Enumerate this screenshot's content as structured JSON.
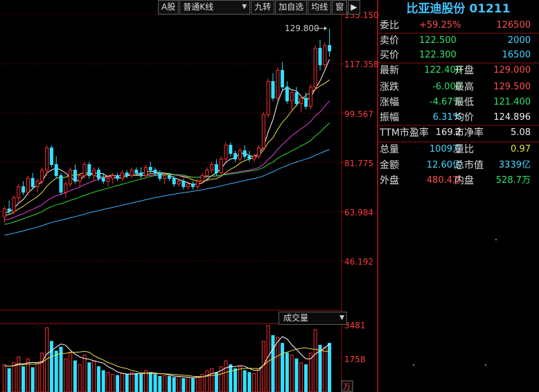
{
  "toolbar": {
    "a_share": "A股",
    "kline_type": "普通K线",
    "nine_turn": "九转",
    "add_watch": "加自选",
    "ma_line": "均线",
    "window": "窗"
  },
  "price_axis": [
    "135.150",
    "117.358",
    "99.567",
    "81.775",
    "63.984",
    "46.192"
  ],
  "price_range": [
    28.4,
    135.15
  ],
  "high_marker": "129.800",
  "volume": {
    "selector": "成交量",
    "axis": [
      "3481",
      "1758"
    ],
    "unit": "万",
    "max": 3481
  },
  "colors": {
    "up": "#ff3030",
    "down": "#35e0ff",
    "ma5": "#ffffff",
    "ma10": "#e8e04a",
    "ma20": "#e040e0",
    "ma30": "#30e030",
    "ma60": "#3cb4ff",
    "grid": "#8b1010"
  },
  "chart_data": {
    "type": "candlestick",
    "candles": [
      [
        62,
        66,
        60,
        65,
        1400
      ],
      [
        65,
        68,
        63,
        64,
        1200
      ],
      [
        64,
        70,
        63,
        69,
        1500
      ],
      [
        69,
        74,
        67,
        73,
        1800
      ],
      [
        73,
        75,
        70,
        71,
        1300
      ],
      [
        71,
        77,
        70,
        76,
        1700
      ],
      [
        76,
        78,
        72,
        73,
        1250
      ],
      [
        73,
        76,
        71,
        75,
        1500
      ],
      [
        75,
        80,
        74,
        79,
        2000
      ],
      [
        79,
        88,
        77,
        87,
        3300
      ],
      [
        87,
        88,
        80,
        81,
        2600
      ],
      [
        81,
        84,
        76,
        77,
        2100
      ],
      [
        77,
        78,
        70,
        71,
        2300
      ],
      [
        71,
        75,
        69,
        74,
        1700
      ],
      [
        74,
        80,
        73,
        79,
        2000
      ],
      [
        79,
        81,
        74,
        75,
        1600
      ],
      [
        75,
        78,
        73,
        77,
        1400
      ],
      [
        77,
        82,
        76,
        81,
        1900
      ],
      [
        81,
        82,
        76,
        77,
        1500
      ],
      [
        77,
        80,
        75,
        79,
        1600
      ],
      [
        79,
        80,
        75,
        76,
        1300
      ],
      [
        76,
        78,
        74,
        75,
        1100
      ],
      [
        75,
        77,
        73,
        76,
        1000
      ],
      [
        76,
        78,
        74,
        77,
        900
      ],
      [
        77,
        78,
        75,
        76,
        850
      ],
      [
        76,
        79,
        75,
        78,
        950
      ],
      [
        78,
        79,
        76,
        77,
        900
      ],
      [
        77,
        80,
        76,
        79,
        1000
      ],
      [
        79,
        80,
        77,
        78,
        950
      ],
      [
        78,
        80,
        76,
        77,
        900
      ],
      [
        77,
        81,
        76,
        80,
        1100
      ],
      [
        80,
        82,
        78,
        79,
        1000
      ],
      [
        79,
        80,
        77,
        78,
        900
      ],
      [
        78,
        79,
        75,
        76,
        800
      ],
      [
        76,
        78,
        74,
        77,
        850
      ],
      [
        77,
        78,
        75,
        76,
        800
      ],
      [
        76,
        77,
        73,
        74,
        750
      ],
      [
        74,
        76,
        73,
        75,
        800
      ],
      [
        75,
        76,
        72,
        73,
        700
      ],
      [
        73,
        75,
        72,
        74,
        750
      ],
      [
        74,
        75,
        72,
        73,
        700
      ],
      [
        73,
        76,
        72,
        75,
        800
      ],
      [
        75,
        78,
        74,
        77,
        900
      ],
      [
        77,
        80,
        76,
        79,
        1100
      ],
      [
        79,
        82,
        78,
        81,
        1200
      ],
      [
        81,
        83,
        77,
        78,
        1000
      ],
      [
        78,
        84,
        77,
        83,
        1300
      ],
      [
        83,
        89,
        82,
        88,
        1600
      ],
      [
        88,
        89,
        84,
        85,
        1400
      ],
      [
        85,
        86,
        82,
        83,
        1200
      ],
      [
        83,
        87,
        82,
        86,
        1300
      ],
      [
        86,
        88,
        83,
        84,
        1100
      ],
      [
        84,
        86,
        82,
        83,
        1000
      ],
      [
        83,
        85,
        82,
        84,
        950
      ],
      [
        84,
        88,
        83,
        87,
        1200
      ],
      [
        87,
        100,
        86,
        99,
        2600
      ],
      [
        99,
        112,
        98,
        111,
        3400
      ],
      [
        111,
        114,
        104,
        105,
        2900
      ],
      [
        105,
        116,
        104,
        115,
        2800
      ],
      [
        115,
        118,
        108,
        109,
        2500
      ],
      [
        109,
        111,
        103,
        104,
        2000
      ],
      [
        104,
        108,
        100,
        107,
        1900
      ],
      [
        107,
        109,
        102,
        103,
        1700
      ],
      [
        103,
        106,
        100,
        105,
        1500
      ],
      [
        105,
        107,
        101,
        102,
        1400
      ],
      [
        102,
        110,
        101,
        109,
        2000
      ],
      [
        109,
        124,
        108,
        123,
        3200
      ],
      [
        123,
        126,
        115,
        117,
        2400
      ],
      [
        117,
        125,
        116,
        124,
        2300
      ],
      [
        124,
        130,
        120,
        122,
        2500
      ]
    ],
    "ma_periods": [
      5,
      10,
      20,
      30,
      60
    ],
    "volume_ma_periods": [
      5,
      10
    ]
  },
  "panel": {
    "title": "比亚迪股份 01211",
    "weibi": {
      "label": "委比",
      "pct": "+59.25%",
      "val": "126500"
    },
    "sell": {
      "label": "卖价",
      "price": "122.500",
      "vol": "2000"
    },
    "buy": {
      "label": "买价",
      "price": "122.300",
      "vol": "16500"
    },
    "rows": [
      {
        "l1": "最新",
        "v1": "122.400",
        "c1": "green",
        "l2": "开盘",
        "v2": "129.000",
        "c2": "red"
      },
      {
        "l1": "涨跌",
        "v1": "-6.000",
        "c1": "green",
        "l2": "最高",
        "v2": "129.500",
        "c2": "red"
      },
      {
        "l1": "涨幅",
        "v1": "-4.67%",
        "c1": "green",
        "l2": "最低",
        "v2": "121.400",
        "c2": "green"
      },
      {
        "l1": "振幅",
        "v1": "6.31%",
        "c1": "cyan",
        "l2": "均价",
        "v2": "124.896",
        "c2": "white"
      },
      {
        "l1": "TTM市盈率",
        "v1": "169.2",
        "c1": "white",
        "l2": "市净率",
        "v2": "5.08",
        "c2": "white"
      },
      {
        "l1": "总量",
        "v1": "1009万",
        "c1": "cyan",
        "l2": "量比",
        "v2": "0.97",
        "c2": "yellow"
      },
      {
        "l1": "金额",
        "v1": "12.60亿",
        "c1": "cyan",
        "l2": "总市值",
        "v2": "3339亿",
        "c2": "cyan"
      },
      {
        "l1": "外盘",
        "v1": "480.4万",
        "c1": "red",
        "l2": "内盘",
        "v2": "528.7万",
        "c2": "green"
      }
    ]
  }
}
